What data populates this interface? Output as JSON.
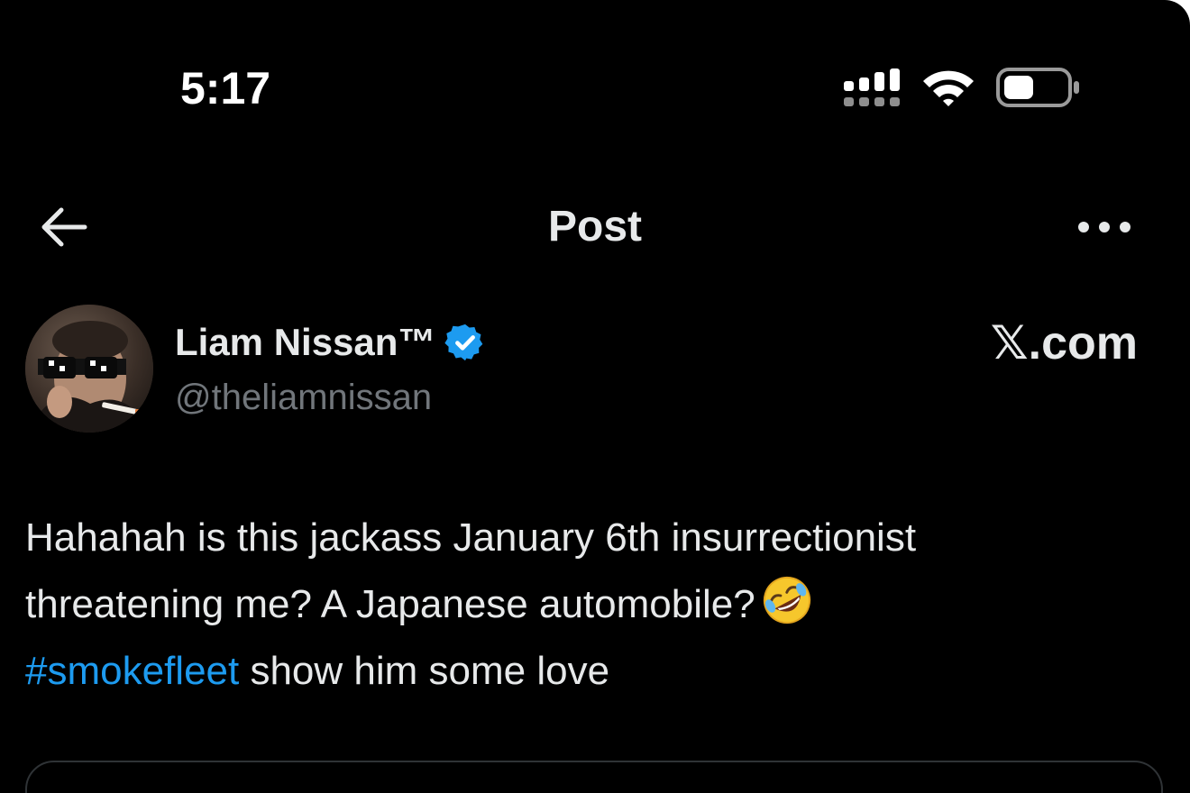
{
  "status_bar": {
    "time": "5:17",
    "icons": [
      "signal-icon",
      "wifi-icon",
      "battery-icon"
    ]
  },
  "header": {
    "title": "Post",
    "back_icon": "arrow-left-icon",
    "more_icon": "more-horizontal-icon"
  },
  "author": {
    "name": "Liam Nissan™",
    "handle": "@theliamnissan",
    "verified": true,
    "verified_color": "#1d9bf0"
  },
  "watermark": "𝕏.com",
  "post": {
    "line1": "Hahahah is this jackass January 6th insurrectionist",
    "line2": "threatening me? A Japanese automobile?",
    "emoji": "rolling-on-the-floor-laughing-emoji",
    "hashtag": "#smokefleet",
    "line3_rest": " show him some love"
  },
  "colors": {
    "background": "#000000",
    "text": "#e7e9ea",
    "secondary_text": "#71767b",
    "link": "#1d9bf0"
  }
}
